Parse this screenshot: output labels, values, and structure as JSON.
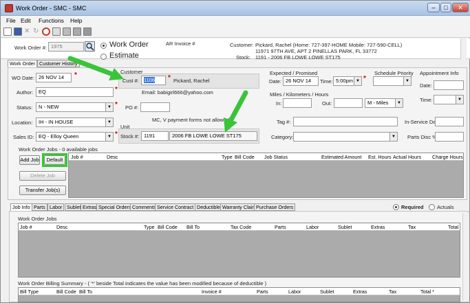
{
  "window": {
    "title": "Work Order - SMC - SMC"
  },
  "menu": [
    "File",
    "Edit",
    "Functions",
    "Help"
  ],
  "header": {
    "wo_label": "Work Order #:",
    "wo_value": "1975",
    "radio_work_order": "Work Order",
    "radio_estimate": "Estimate",
    "ar_invoice_label": "AR Invoice #",
    "customer_label": "Customer:",
    "customer_line1": "Pickard, Rachel (Home: 727-397-HOME  Mobile: 727-590-CELL)",
    "customer_line2": "11971 97TH AVE, APT 2 PINELLAS PARK, FL 33772",
    "stock_label": "Stock:",
    "stock_line": "1191 - 2006 FB LOWE LOWE ST175"
  },
  "top_tabs": [
    "Work Order",
    "Customer History"
  ],
  "form": {
    "wo_date_label": "WO Date:",
    "wo_date": "26 NOV 14",
    "author_label": "Author:",
    "author": "EQ",
    "status_label": "Status:",
    "status": "N - NEW",
    "location_label": "Location:",
    "location": "IH - IN HOUSE",
    "sales_label": "Sales ID:",
    "sales": "EQ - Elloy Queen",
    "customer_group": "Customer",
    "cust_label": "Cust #:",
    "cust_num": "1106",
    "cust_name": "Pickard, Rachel",
    "email": "Email: babigirl666@yahoo.com",
    "po_label": "PO #:",
    "po": "",
    "mcv_note": "MC, V payment forms not allowed.",
    "unit_group": "Unit",
    "stock_label": "Stock #:",
    "stock_num": "1191",
    "stock_desc": "2006 FB LOWE LOWE ST175",
    "expected_group": "Expected / Promised",
    "date_label": "Date:",
    "date": "26 NOV 14",
    "time_label": "Time:",
    "time": "5:00pm",
    "schedule_group": "Schedule Priority",
    "appt_group": "Appointment Info",
    "appt_date_label": "Date:",
    "appt_time_label": "Time:",
    "miles_group": "Miles / Kilometers / Hours",
    "in_label": "In:",
    "out_label": "Out:",
    "miles_unit": "M - Miles",
    "tag_label": "Tag #:",
    "inservice_label": "In-Service Date:",
    "category_label": "Category:",
    "parts_disc_label": "Parts Disc %:"
  },
  "jobs_section": {
    "title": "Work Order Jobs - 0 available jobs",
    "buttons": [
      "Add Job",
      "Default",
      "Delete Job",
      "Transfer Job(s)"
    ],
    "columns": [
      "Job #",
      "Desc",
      "Type",
      "Bill Code",
      "Job Status",
      "Estimated Amount",
      "Est. Hours",
      "Actual Hours",
      "Charge Hours"
    ]
  },
  "bottom_tabs": [
    "Job Info",
    "Parts",
    "Labor",
    "Sublet",
    "Extras",
    "Special Orders",
    "Comments",
    "Service Contract",
    "Deductible",
    "Warranty Claim",
    "Purchase Orders"
  ],
  "required_label": "Required",
  "actuals_label": "Actuals",
  "wo_jobs": {
    "title": "Work Order Jobs",
    "columns": [
      "Job #",
      "Desc",
      "Type",
      "Bill Code",
      "Bill To",
      "Tax Code",
      "Parts",
      "Labor",
      "Sublet",
      "Extras",
      "Tax",
      "Total"
    ]
  },
  "billing": {
    "title": "Work Order Billing Summary - ( '*' beside Total indicates the value has been modified because of deductible )",
    "columns": [
      "Bill Type",
      "Bill Code",
      "Bill To",
      "Invoice #",
      "Parts",
      "Labor",
      "Sublet",
      "Extras",
      "Tax",
      "Total *"
    ]
  },
  "colors": {
    "arrow": "#3ac43a",
    "highlight": "#2ecc2e",
    "required": "#d00000",
    "grid": "#ababab"
  }
}
